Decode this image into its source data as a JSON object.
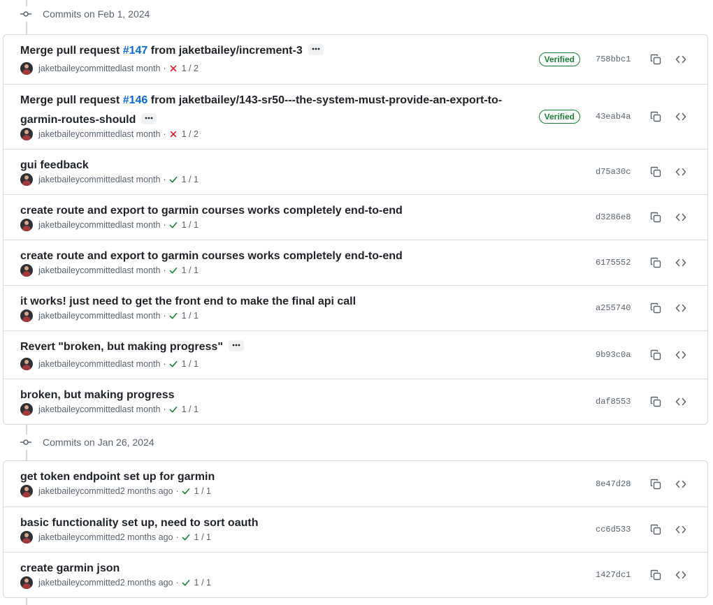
{
  "groups": [
    {
      "date": "Commits on Feb 1, 2024",
      "commits": [
        {
          "title_pre": "Merge pull request ",
          "pr": "#147",
          "title_post": " from jaketbailey/increment-3",
          "ellipsis": true,
          "author": "jaketbailey",
          "committed": "committed",
          "time": "last month",
          "sep": "·",
          "status": "fail",
          "checks": "1 / 2",
          "verified": "Verified",
          "sha": "758bbc1"
        },
        {
          "title_pre": "Merge pull request ",
          "pr": "#146",
          "title_post": " from jaketbailey/143-sr50---the-system-must-provide-an-export-to-garmin-routes-should",
          "ellipsis": true,
          "author": "jaketbailey",
          "committed": "committed",
          "time": "last month",
          "sep": "·",
          "status": "fail",
          "checks": "1 / 2",
          "verified": "Verified",
          "sha": "43eab4a"
        },
        {
          "title_pre": "gui feedback",
          "pr": "",
          "title_post": "",
          "ellipsis": false,
          "author": "jaketbailey",
          "committed": "committed",
          "time": "last month",
          "sep": "·",
          "status": "pass",
          "checks": "1 / 1",
          "verified": "",
          "sha": "d75a30c"
        },
        {
          "title_pre": "create route and export to garmin courses works completely end-to-end",
          "pr": "",
          "title_post": "",
          "ellipsis": false,
          "author": "jaketbailey",
          "committed": "committed",
          "time": "last month",
          "sep": "·",
          "status": "pass",
          "checks": "1 / 1",
          "verified": "",
          "sha": "d3286e8"
        },
        {
          "title_pre": "create route and export to garmin courses works completely end-to-end",
          "pr": "",
          "title_post": "",
          "ellipsis": false,
          "author": "jaketbailey",
          "committed": "committed",
          "time": "last month",
          "sep": "·",
          "status": "pass",
          "checks": "1 / 1",
          "verified": "",
          "sha": "6175552"
        },
        {
          "title_pre": "it works! just need to get the front end to make the final api call",
          "pr": "",
          "title_post": "",
          "ellipsis": false,
          "author": "jaketbailey",
          "committed": "committed",
          "time": "last month",
          "sep": "·",
          "status": "pass",
          "checks": "1 / 1",
          "verified": "",
          "sha": "a255740"
        },
        {
          "title_pre": "Revert \"broken, but making progress\"",
          "pr": "",
          "title_post": "",
          "ellipsis": true,
          "author": "jaketbailey",
          "committed": "committed",
          "time": "last month",
          "sep": "·",
          "status": "pass",
          "checks": "1 / 1",
          "verified": "",
          "sha": "9b93c0a"
        },
        {
          "title_pre": "broken, but making progress",
          "pr": "",
          "title_post": "",
          "ellipsis": false,
          "author": "jaketbailey",
          "committed": "committed",
          "time": "last month",
          "sep": "·",
          "status": "pass",
          "checks": "1 / 1",
          "verified": "",
          "sha": "daf8553"
        }
      ]
    },
    {
      "date": "Commits on Jan 26, 2024",
      "commits": [
        {
          "title_pre": "get token endpoint set up for garmin",
          "pr": "",
          "title_post": "",
          "ellipsis": false,
          "author": "jaketbailey",
          "committed": "committed",
          "time": "2 months ago",
          "sep": "·",
          "status": "pass",
          "checks": "1 / 1",
          "verified": "",
          "sha": "8e47d28"
        },
        {
          "title_pre": "basic functionality set up, need to sort oauth",
          "pr": "",
          "title_post": "",
          "ellipsis": false,
          "author": "jaketbailey",
          "committed": "committed",
          "time": "2 months ago",
          "sep": "·",
          "status": "pass",
          "checks": "1 / 1",
          "verified": "",
          "sha": "cc6d533"
        },
        {
          "title_pre": "create garmin json",
          "pr": "",
          "title_post": "",
          "ellipsis": false,
          "author": "jaketbailey",
          "committed": "committed",
          "time": "2 months ago",
          "sep": "·",
          "status": "pass",
          "checks": "1 / 1",
          "verified": "",
          "sha": "1427dc1"
        }
      ]
    }
  ],
  "icons": {
    "timeline": "git-commit-icon",
    "ellipsis": "kebab-horizontal-icon",
    "fail": "x-icon",
    "pass": "check-icon",
    "copy": "copy-icon",
    "browse": "code-icon"
  },
  "colors": {
    "link": "#0969da",
    "success": "#1a7f37",
    "danger": "#cf222e",
    "muted": "#59636e",
    "border": "#d0d7de"
  }
}
